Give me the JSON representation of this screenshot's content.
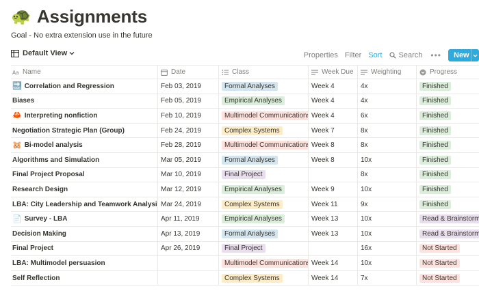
{
  "page": {
    "icon": "turtle-icon",
    "icon_glyph": "🐢",
    "title": "Assignments",
    "description": "Goal - No extra extension use in the future"
  },
  "toolbar": {
    "view_label": "Default View",
    "properties_label": "Properties",
    "filter_label": "Filter",
    "sort_label": "Sort",
    "search_label": "Search",
    "more_label": "•••",
    "new_label": "New"
  },
  "columns": {
    "name": "Name",
    "date": "Date",
    "class": "Class",
    "week_due": "Week Due",
    "weighting": "Weighting",
    "progress": "Progress"
  },
  "rows": [
    {
      "icon": "🔜",
      "name": "Correlation and Regression",
      "date": "Feb 03, 2019",
      "class": "Formal Analyses",
      "class_key": "formal",
      "week": "Week 4",
      "weighting": "4x",
      "progress": "Finished",
      "progress_key": "finished"
    },
    {
      "icon": "",
      "name": "Biases",
      "date": "Feb 05, 2019",
      "class": "Empirical Analyses",
      "class_key": "empirical",
      "week": "Week 4",
      "weighting": "4x",
      "progress": "Finished",
      "progress_key": "finished"
    },
    {
      "icon": "🦀",
      "name": "Interpreting nonfiction",
      "date": "Feb 10, 2019",
      "class": "Multimodel Communications",
      "class_key": "multimodel",
      "week": "Week 4",
      "weighting": "6x",
      "progress": "Finished",
      "progress_key": "finished"
    },
    {
      "icon": "",
      "name": "Negotiation Strategic Plan (Group)",
      "date": "Feb 24, 2019",
      "class": "Complex Systems",
      "class_key": "complex",
      "week": "Week 7",
      "weighting": "8x",
      "progress": "Finished",
      "progress_key": "finished"
    },
    {
      "icon": "🐹",
      "name": "Bi-model analysis",
      "date": "Feb 28, 2019",
      "class": "Multimodel Communications",
      "class_key": "multimodel",
      "week": "Week 8",
      "weighting": "8x",
      "progress": "Finished",
      "progress_key": "finished"
    },
    {
      "icon": "",
      "name": "Algorithms and Simulation",
      "date": "Mar 05, 2019",
      "class": "Formal Analyses",
      "class_key": "formal",
      "week": "Week 8",
      "weighting": "10x",
      "progress": "Finished",
      "progress_key": "finished"
    },
    {
      "icon": "",
      "name": "Final Project Proposal",
      "date": "Mar 10, 2019",
      "class": "Final Project",
      "class_key": "final",
      "week": "",
      "weighting": "8x",
      "progress": "Finished",
      "progress_key": "finished"
    },
    {
      "icon": "",
      "name": "Research Design",
      "date": "Mar 12, 2019",
      "class": "Empirical Analyses",
      "class_key": "empirical",
      "week": "Week 9",
      "weighting": "10x",
      "progress": "Finished",
      "progress_key": "finished"
    },
    {
      "icon": "",
      "name": "LBA: City Leadership and Teamwork Analysis",
      "date": "Mar 24, 2019",
      "class": "Complex Systems",
      "class_key": "complex",
      "week": "Week 11",
      "weighting": "9x",
      "progress": "Finished",
      "progress_key": "finished"
    },
    {
      "icon": "📄",
      "name": "Survey - LBA",
      "date": "Apr 11, 2019",
      "class": "Empirical Analyses",
      "class_key": "empirical",
      "week": "Week 13",
      "weighting": "10x",
      "progress": "Read & Brainstorming",
      "progress_key": "read"
    },
    {
      "icon": "",
      "name": "Decision Making",
      "date": "Apr 13, 2019",
      "class": "Formal Analyses",
      "class_key": "formal",
      "week": "Week 13",
      "weighting": "10x",
      "progress": "Read & Brainstorming",
      "progress_key": "read"
    },
    {
      "icon": "",
      "name": "Final Project",
      "date": "Apr 26, 2019",
      "class": "Final Project",
      "class_key": "final",
      "week": "",
      "weighting": "16x",
      "progress": "Not Started",
      "progress_key": "notstarted"
    },
    {
      "icon": "",
      "name": "LBA: Multimodel persuasion",
      "date": "",
      "class": "Multimodel Communications",
      "class_key": "multimodel",
      "week": "Week 14",
      "weighting": "10x",
      "progress": "Not Started",
      "progress_key": "notstarted"
    },
    {
      "icon": "",
      "name": "Self Reflection",
      "date": "",
      "class": "Complex Systems",
      "class_key": "complex",
      "week": "Week 14",
      "weighting": "7x",
      "progress": "Not Started",
      "progress_key": "notstarted"
    }
  ],
  "colors": {
    "accent": "#2eaadc",
    "tag_formal": "#d3e5ef",
    "tag_empirical": "#dbeddb",
    "tag_multimodel": "#ffe2dd",
    "tag_complex": "#fdecc8",
    "tag_final": "#e8deee"
  }
}
